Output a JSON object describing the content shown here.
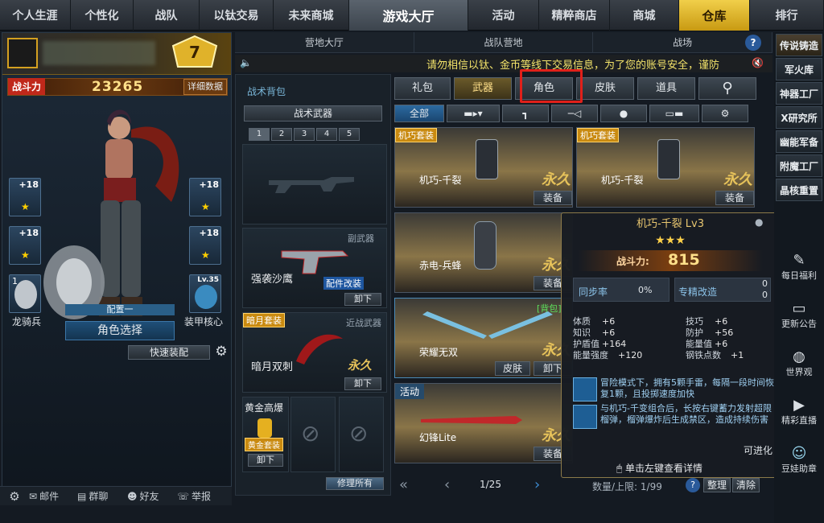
{
  "top_nav": {
    "items": [
      "个人生涯",
      "个性化",
      "战队",
      "以钛交易",
      "未来商城",
      "游戏大厅",
      "活动",
      "精粹商店",
      "商城",
      "仓库",
      "排行"
    ],
    "active": "游戏大厅",
    "highlight": "仓库"
  },
  "player": {
    "rank_level": "7",
    "power_label": "战斗力",
    "power_value": "23265",
    "detail_label": "详细数据"
  },
  "equip_slots": {
    "left1_level": "+18",
    "left2_level": "+18",
    "right1_level": "+18",
    "right2_level": "+18",
    "pet_count": "1",
    "armor_level": "Lv.35"
  },
  "character": {
    "pet_label": "龙骑兵",
    "armor_label": "装甲核心",
    "config_label": "配置一",
    "select_label": "角色选择",
    "quick_label": "快速装配"
  },
  "bottom_bar": {
    "mail": "邮件",
    "group_chat": "群聊",
    "friends": "好友",
    "report": "举报"
  },
  "sub_nav": [
    "营地大厅",
    "战队营地",
    "战场"
  ],
  "marquee": "请勿相信以钛、金币等线下交易信息，为了您的账号安全，谨防",
  "backpack": {
    "title": "战术背包",
    "weapons_tab": "战术武器",
    "pages": [
      "1",
      "2",
      "3",
      "4",
      "5"
    ],
    "secondary_label": "副武器",
    "secondary_name": "强袭沙鹰",
    "secondary_mod": "配件改装",
    "unequip": "卸下",
    "melee_set_badge": "暗月套装",
    "melee_label": "近战武器",
    "melee_name": "暗月双刺",
    "melee_perm": "永久",
    "grenade_name": "黄金高爆",
    "grenade_badge": "黄金套装",
    "repair_all": "修理所有"
  },
  "categories": [
    "礼包",
    "武器",
    "角色",
    "皮肤",
    "道具"
  ],
  "active_category": "武器",
  "filters": {
    "all": "全部"
  },
  "items": [
    {
      "badge": "机巧套装",
      "name": "机巧-千裂",
      "perm": "永久",
      "action": "装备"
    },
    {
      "badge": "机巧套装",
      "name": "机巧-千裂",
      "perm": "永久",
      "action": "装备"
    },
    {
      "badge": "",
      "name": "赤电-兵蜂",
      "perm": "永久",
      "action": "装备"
    },
    {
      "badge": "",
      "name": "荣耀无双",
      "perm": "永久",
      "action": "卸下",
      "tag": "[背包]",
      "skin": "皮肤"
    },
    {
      "badge": "活动",
      "name": "幻锋Lite",
      "perm": "永久",
      "action": "装备"
    }
  ],
  "pagination": {
    "page": "1/25",
    "capacity": "数量/上限: 1/99",
    "sort": "整理",
    "clear": "清除"
  },
  "tooltip": {
    "title": "机巧-千裂 Lv3",
    "stars": "★★★",
    "power_label": "战斗力:",
    "power_value": "815",
    "sync_label": "同步率",
    "sync_value": "0%",
    "mod_label": "专精改造",
    "mod_val1": "0",
    "mod_val2": "0",
    "stats": [
      [
        "体质",
        "+6"
      ],
      [
        "技巧",
        "+6"
      ],
      [
        "知识",
        "+6"
      ],
      [
        "防护",
        "+56"
      ],
      [
        "护盾值",
        "+164"
      ],
      [
        "能量值",
        "+6"
      ],
      [
        "能量强度",
        "+120"
      ],
      [
        "钢铁点数",
        "+1"
      ]
    ],
    "skill1": "冒险模式下，拥有5颗手雷，每隔一段时间恢复1颗，且投掷速度加快",
    "skill2": "与机巧-千变组合后，长按右键蓄力发射超限榴弹，榴弹爆炸后生成禁区，造成持续伤害",
    "evolve": "可进化",
    "hint": "单击左键查看详情"
  },
  "right_tabs": [
    "传说铸造",
    "军火库",
    "神器工厂",
    "X研究所",
    "幽能军备",
    "附魔工厂",
    "晶核重置"
  ],
  "right_services": [
    "每日福利",
    "更新公告",
    "世界观",
    "精彩直播",
    "豆娃助章"
  ],
  "colors": {
    "gold": "#f1cf4a",
    "accent_red": "#e0201a",
    "panel": "#192129"
  }
}
